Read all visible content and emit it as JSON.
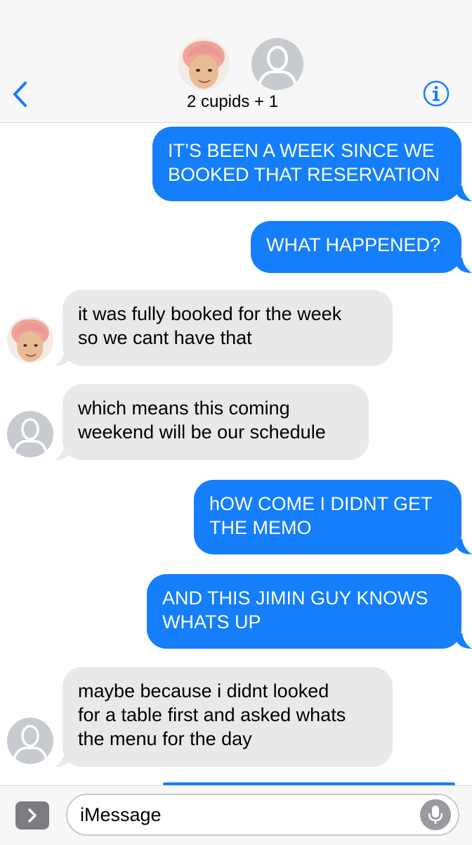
{
  "header": {
    "group_name": "2 cupids + 1",
    "back_icon": "chevron-left-icon",
    "info_icon": "info-icon",
    "accent": "#147efb"
  },
  "messages": [
    {
      "direction": "outgoing",
      "lines": [
        "IT’S BEEN A WEEK SINCE WE",
        "BOOKED THAT RESERVATION"
      ]
    },
    {
      "direction": "outgoing",
      "lines": [
        "WHAT HAPPENED?"
      ]
    },
    {
      "direction": "incoming",
      "sender_avatar": "pink-hair-avatar",
      "lines": [
        "it was fully booked for the week",
        "so we cant have that"
      ]
    },
    {
      "direction": "incoming",
      "sender_avatar": "default-avatar",
      "lines": [
        "which means this coming",
        "weekend will be our schedule"
      ]
    },
    {
      "direction": "outgoing",
      "lines": [
        "hOW COME I DIDNT GET",
        "THE MEMO"
      ]
    },
    {
      "direction": "outgoing",
      "lines": [
        "AND THIS JIMIN GUY KNOWS",
        "WHATS UP"
      ]
    },
    {
      "direction": "incoming",
      "sender_avatar": "default-avatar",
      "lines": [
        "maybe because i didnt looked",
        "for a table first and asked whats",
        "the menu for the day"
      ]
    }
  ],
  "composer": {
    "placeholder": "iMessage",
    "apps_icon": "chevron-right-icon",
    "mic_icon": "microphone-icon"
  },
  "colors": {
    "outgoing_bubble": "#147efb",
    "incoming_bubble": "#e9e9eb",
    "header_bg": "#f7f7f7"
  }
}
